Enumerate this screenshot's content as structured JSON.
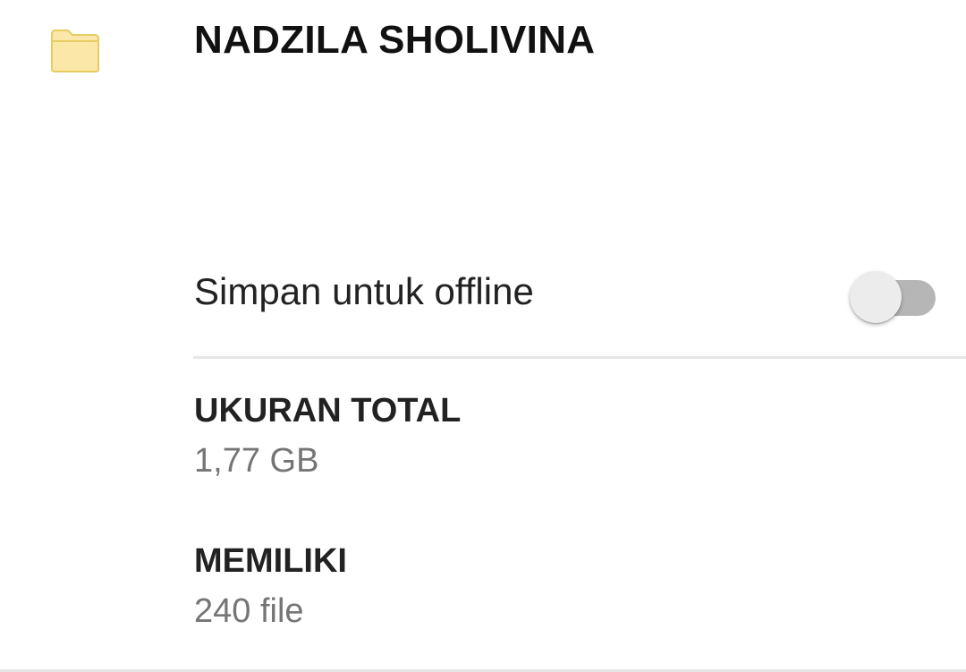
{
  "header": {
    "folder_icon": "folder-icon",
    "title": "NADZILA SHOLIVINA"
  },
  "offline": {
    "label": "Simpan untuk offline",
    "enabled": false
  },
  "details": {
    "total_size_label": "UKURAN TOTAL",
    "total_size_value": "1,77 GB",
    "contains_label": "MEMILIKI",
    "contains_value": "240 file"
  },
  "colors": {
    "folder_fill": "#fbe8a8",
    "folder_stroke": "#e7cc62",
    "toggle_track": "#b6b6b6",
    "toggle_thumb": "#ececec",
    "secondary_text": "#757575"
  }
}
